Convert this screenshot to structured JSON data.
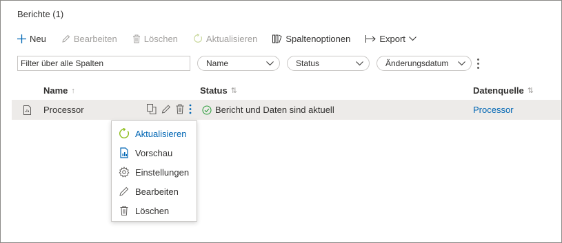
{
  "title": "Berichte (1)",
  "toolbar": {
    "new_label": "Neu",
    "edit_label": "Bearbeiten",
    "delete_label": "Löschen",
    "refresh_label": "Aktualisieren",
    "columns_label": "Spaltenoptionen",
    "export_label": "Export"
  },
  "filters": {
    "search_placeholder": "Filter über alle Spalten",
    "name_filter": "Name",
    "status_filter": "Status",
    "date_filter": "Änderungsdatum"
  },
  "table": {
    "headers": {
      "name": "Name",
      "status": "Status",
      "source": "Datenquelle"
    },
    "rows": [
      {
        "name": "Processor",
        "status": "Bericht und Daten sind aktuell",
        "source": "Processor"
      }
    ]
  },
  "context_menu": {
    "items": [
      {
        "label": "Aktualisieren",
        "icon": "refresh-icon"
      },
      {
        "label": "Vorschau",
        "icon": "report-preview-icon"
      },
      {
        "label": "Einstellungen",
        "icon": "gear-icon"
      },
      {
        "label": "Bearbeiten",
        "icon": "pencil-icon"
      },
      {
        "label": "Löschen",
        "icon": "trash-icon"
      }
    ]
  },
  "colors": {
    "accent": "#0066b4",
    "success": "#2e9e3e",
    "row_highlight": "#edebe9",
    "disabled": "#a19f9d"
  }
}
